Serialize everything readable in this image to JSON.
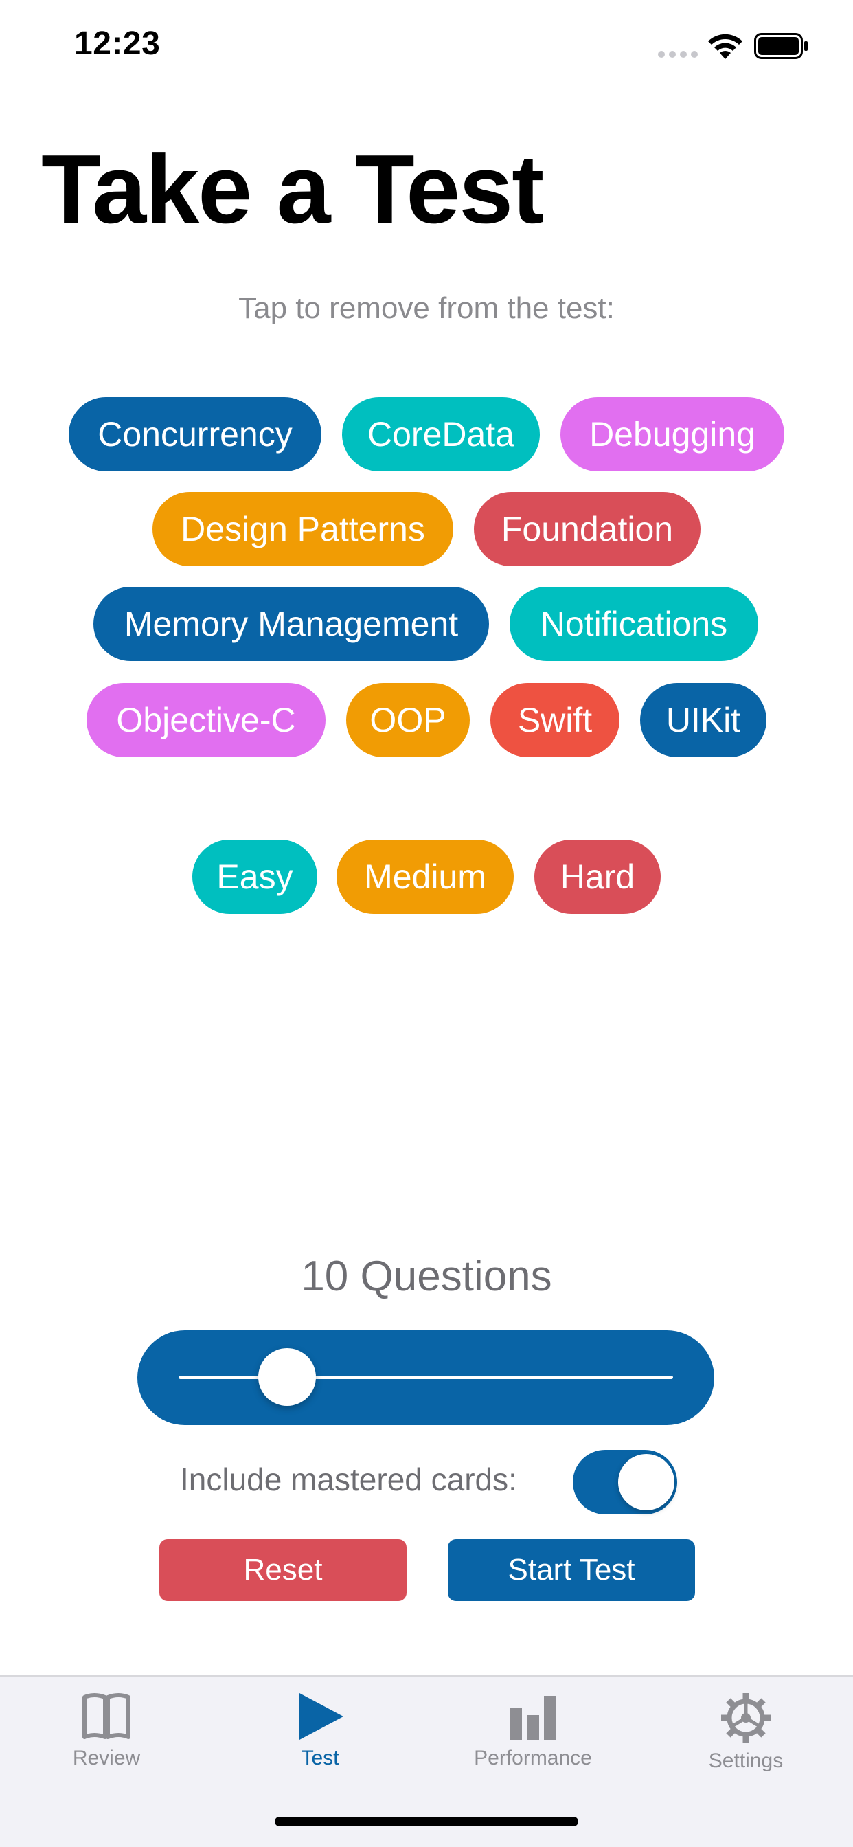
{
  "status_bar": {
    "time": "12:23"
  },
  "page": {
    "title": "Take a Test",
    "instruction": "Tap to remove from the test:"
  },
  "categories": [
    {
      "label": "Concurrency",
      "color": "#0964a6"
    },
    {
      "label": "CoreData",
      "color": "#00bfbf"
    },
    {
      "label": "Debugging",
      "color": "#e16ff0"
    },
    {
      "label": "Design Patterns",
      "color": "#f19c04"
    },
    {
      "label": "Foundation",
      "color": "#d94e58"
    },
    {
      "label": "Memory Management",
      "color": "#0964a6"
    },
    {
      "label": "Notifications",
      "color": "#00bfbf"
    },
    {
      "label": "Objective-C",
      "color": "#e16ff0"
    },
    {
      "label": "OOP",
      "color": "#f19c04"
    },
    {
      "label": "Swift",
      "color": "#ee5241"
    },
    {
      "label": "UIKit",
      "color": "#0964a6"
    }
  ],
  "difficulties": [
    {
      "label": "Easy",
      "color": "#00bfbf"
    },
    {
      "label": "Medium",
      "color": "#f19c04"
    },
    {
      "label": "Hard",
      "color": "#d94e58"
    }
  ],
  "questions": {
    "label": "10 Questions",
    "slider_fraction": 0.22
  },
  "mastered": {
    "label": "Include mastered cards:",
    "enabled": true
  },
  "actions": {
    "reset_label": "Reset",
    "reset_color": "#d94e58",
    "start_label": "Start Test",
    "start_color": "#0964a6"
  },
  "tab_bar": {
    "items": [
      {
        "label": "Review",
        "icon": "book-icon",
        "active": false
      },
      {
        "label": "Test",
        "icon": "play-icon",
        "active": true
      },
      {
        "label": "Performance",
        "icon": "bar-chart-icon",
        "active": false
      },
      {
        "label": "Settings",
        "icon": "gear-icon",
        "active": false
      }
    ],
    "active_color": "#0964a6",
    "inactive_color": "#8e8e93"
  }
}
